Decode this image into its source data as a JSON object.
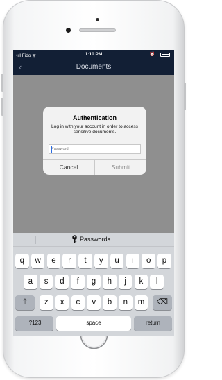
{
  "status_bar": {
    "carrier": "•ıll Fido ᯤ",
    "time": "1:10 PM",
    "alarm": "⏰"
  },
  "nav": {
    "back_icon": "chevron-left-icon",
    "back_glyph": "‹",
    "title": "Documents"
  },
  "dialog": {
    "title": "Authentication",
    "message": "Log in with your account in order to access sensitive documents.",
    "input_placeholder": "Password",
    "input_value": "",
    "cancel_label": "Cancel",
    "submit_label": "Submit"
  },
  "keyboard": {
    "suggestion_label": "Passwords",
    "suggestion_icon": "key-icon",
    "row1": [
      "q",
      "w",
      "e",
      "r",
      "t",
      "y",
      "u",
      "i",
      "o",
      "p"
    ],
    "row2": [
      "a",
      "s",
      "d",
      "f",
      "g",
      "h",
      "j",
      "k",
      "l"
    ],
    "row3": [
      "z",
      "x",
      "c",
      "v",
      "b",
      "n",
      "m"
    ],
    "shift_glyph": "⇧",
    "delete_glyph": "⌫",
    "numbers_label": ".?123",
    "space_label": "space",
    "return_label": "return"
  },
  "colors": {
    "nav_background": "#121f35",
    "overlay": "#8f8f8f",
    "dialog_background": "#f2f2f2",
    "keyboard_background": "#d3d6da"
  }
}
